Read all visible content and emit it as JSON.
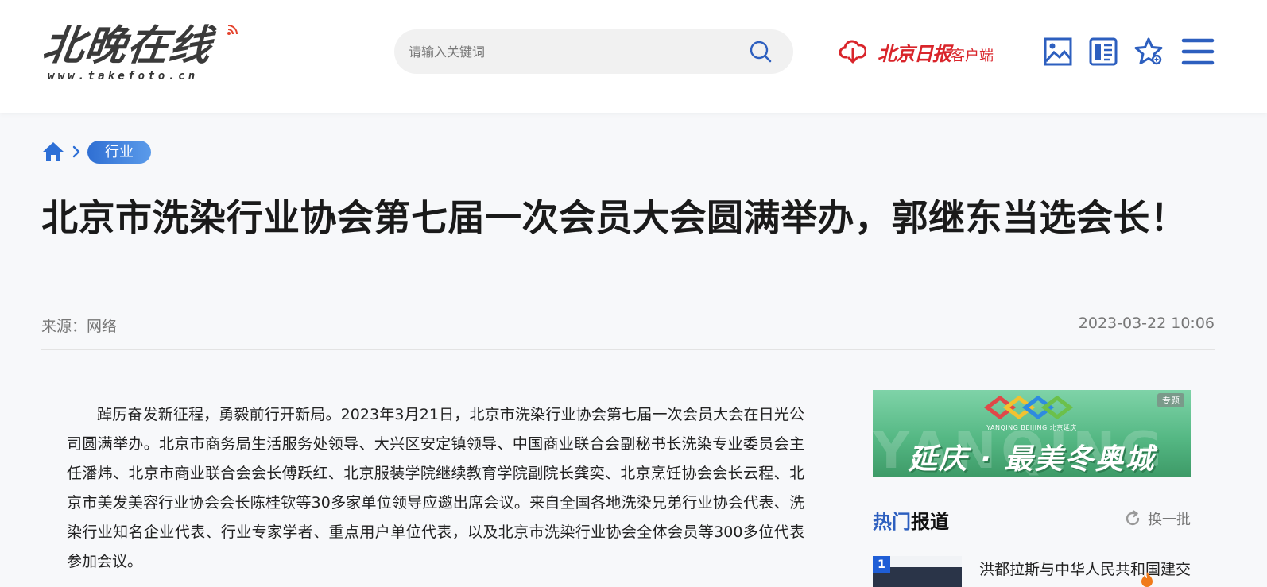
{
  "header": {
    "logo_text": "北晚在线",
    "logo_url": "www.takefoto.cn",
    "search": {
      "placeholder": "请输入关键词"
    },
    "app": {
      "name": "北京日报",
      "suffix": "客户端"
    },
    "icons": [
      "cloud-download-icon",
      "search-icon",
      "image-gallery-icon",
      "report-icon",
      "favorite-star-icon",
      "menu-icon"
    ],
    "brand_color": "#2d5fbf",
    "app_color": "#d9252b"
  },
  "breadcrumb": {
    "home_icon": "home-icon",
    "category": "行业"
  },
  "article": {
    "title": "北京市洗染行业协会第七届一次会员大会圆满举办，郭继东当选会长！",
    "source": "来源：网络",
    "date": "2023-03-22 10:06",
    "paragraphs": [
      "踔厉奋发新征程，勇毅前行开新局。2023年3月21日，北京市洗染行业协会第七届一次会员大会在日光公司圆满举办。北京市商务局生活服务处领导、大兴区安定镇领导、中国商业联合会副秘书长洗染专业委员会主任潘炜、北京市商业联合会会长傅跃红、北京服装学院继续教育学院副院长龚奕、北京烹饪协会会长云程、北京市美发美容行业协会会长陈桂钦等30多家单位领导应邀出席会议。来自全国各地洗染兄弟行业协会代表、洗染行业知名企业代表、行业专家学者、重点用户单位代表，以及北京市洗染行业协会全体会员等300多位代表参加会议。"
    ]
  },
  "sidebar": {
    "banner": {
      "badge": "专题",
      "subtitle": "YANQING BEIJING 北京延庆",
      "headline": "延庆 · 最美冬奥城",
      "ghost": "YANQING"
    },
    "hot": {
      "title_highlight": "热门",
      "title_rest": "报道",
      "refresh_label": "换一批",
      "items": [
        {
          "rank": "1",
          "text": "洪都拉斯与中华人民共和国建交"
        }
      ]
    }
  }
}
